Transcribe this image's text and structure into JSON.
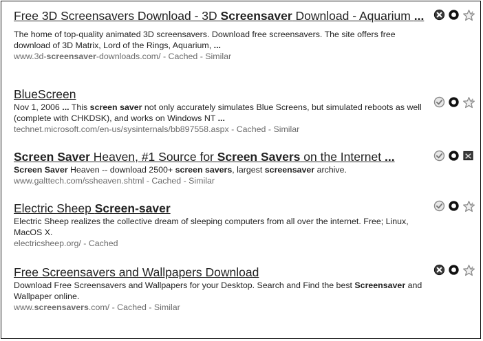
{
  "results": [
    {
      "title_parts": [
        {
          "t": "Free 3D Screensavers Download - 3D ",
          "b": false
        },
        {
          "t": "Screensaver",
          "b": true
        },
        {
          "t": " Download - Aquarium ",
          "b": false
        },
        {
          "t": "...",
          "b": true
        }
      ],
      "snippet_parts": [
        {
          "t": "The home of top-quality animated 3D screensavers. Download free screensavers. The site offers free download of 3D Matrix, Lord of the Rings, Aquarium, ",
          "b": false
        },
        {
          "t": "...",
          "b": true
        }
      ],
      "url_parts": [
        {
          "t": "www.3d-",
          "b": false
        },
        {
          "t": "screensaver",
          "b": true
        },
        {
          "t": "-downloads.com/",
          "b": false
        }
      ],
      "links": [
        "Cached",
        "Similar"
      ],
      "icons": [
        "remove-icon",
        "promote-icon",
        "star-icon"
      ]
    },
    {
      "title_parts": [
        {
          "t": "BlueScreen",
          "b": false
        }
      ],
      "snippet_parts": [
        {
          "t": "Nov 1, 2006 ",
          "b": false
        },
        {
          "t": "...",
          "b": true
        },
        {
          "t": " This ",
          "b": false
        },
        {
          "t": "screen saver",
          "b": true
        },
        {
          "t": " not only accurately simulates Blue Screens, but simulated reboots as well (complete with CHKDSK), and works on Windows NT ",
          "b": false
        },
        {
          "t": "...",
          "b": true
        }
      ],
      "url_parts": [
        {
          "t": "technet.microsoft.com/en-us/sysinternals/bb897558.aspx",
          "b": false
        }
      ],
      "links": [
        "Cached",
        "Similar"
      ],
      "icons": [
        "promoted-check-icon",
        "promote-icon",
        "star-icon"
      ]
    },
    {
      "title_parts": [
        {
          "t": "Screen Saver",
          "b": true
        },
        {
          "t": " Heaven, #1 Source for ",
          "b": false
        },
        {
          "t": "Screen Savers",
          "b": true
        },
        {
          "t": " on the Internet ",
          "b": false
        },
        {
          "t": "...",
          "b": true
        }
      ],
      "snippet_parts": [
        {
          "t": "Screen Saver",
          "b": true
        },
        {
          "t": " Heaven -- download 2500+ ",
          "b": false
        },
        {
          "t": "screen savers",
          "b": true
        },
        {
          "t": ", largest ",
          "b": false
        },
        {
          "t": "screensaver",
          "b": true
        },
        {
          "t": " archive.",
          "b": false
        }
      ],
      "url_parts": [
        {
          "t": "www.galttech.com/ssheaven.shtml",
          "b": false
        }
      ],
      "links": [
        "Cached",
        "Similar"
      ],
      "icons": [
        "promoted-check-icon",
        "promote-icon",
        "comment-box-icon"
      ]
    },
    {
      "title_parts": [
        {
          "t": "Electric Sheep ",
          "b": false
        },
        {
          "t": "Screen-saver",
          "b": true
        }
      ],
      "snippet_parts": [
        {
          "t": "Electric Sheep realizes the collective dream of sleeping computers from all over the internet. Free; Linux, MacOS X.",
          "b": false
        }
      ],
      "url_parts": [
        {
          "t": "electricsheep.org/",
          "b": false
        }
      ],
      "links": [
        "Cached"
      ],
      "icons": [
        "promoted-check-icon",
        "promote-icon",
        "star-icon"
      ]
    },
    {
      "title_parts": [
        {
          "t": "Free Screensavers and Wallpapers Download",
          "b": false
        }
      ],
      "snippet_parts": [
        {
          "t": "Download Free Screensavers and Wallpapers for your Desktop. Search and Find the best ",
          "b": false
        },
        {
          "t": "Screensaver",
          "b": true
        },
        {
          "t": " and Wallpaper online.",
          "b": false
        }
      ],
      "url_parts": [
        {
          "t": "www.",
          "b": false
        },
        {
          "t": "screensavers",
          "b": true
        },
        {
          "t": ".com/",
          "b": false
        }
      ],
      "links": [
        "Cached",
        "Similar"
      ],
      "icons": [
        "remove-icon",
        "promote-icon",
        "star-icon"
      ]
    }
  ]
}
